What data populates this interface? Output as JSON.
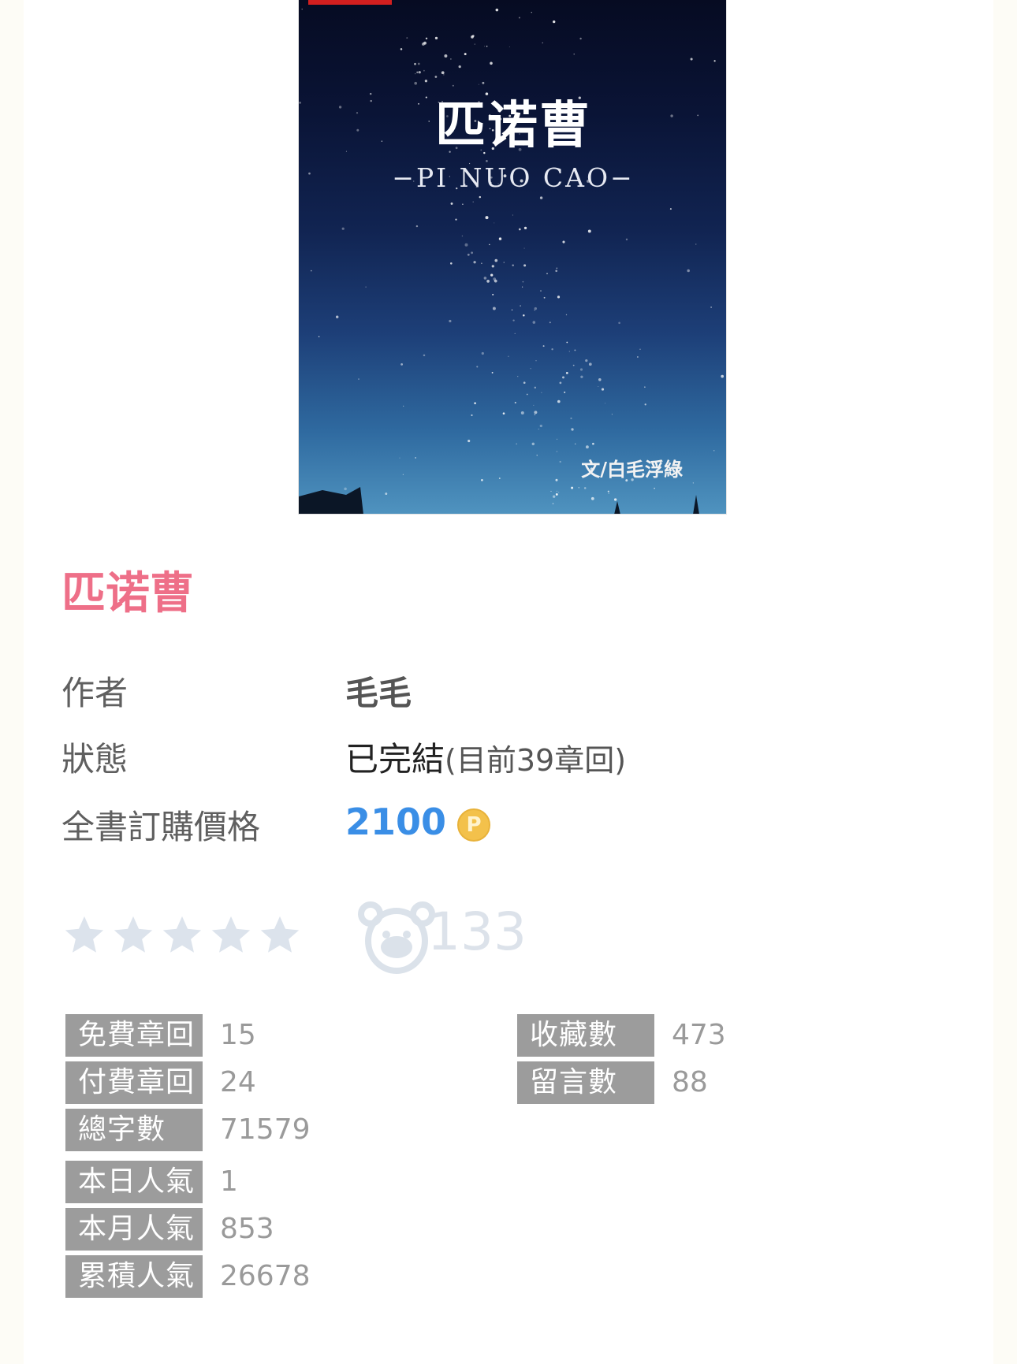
{
  "cover": {
    "title": "匹诺曹",
    "subtitle": "−PI NUO CAO−",
    "author_line": "文/白毛浮綠"
  },
  "book": {
    "title": "匹诺曹"
  },
  "info": {
    "author_label": "作者",
    "author_value": "毛毛",
    "status_label": "狀態",
    "status_value": "已完結",
    "status_detail": "(目前39章回)",
    "price_label": "全書訂購價格",
    "price_value": "2100",
    "coin_symbol": "P"
  },
  "rating": {
    "stars_filled": 0,
    "stars_total": 5,
    "star_color": "#dce3ec",
    "fans_icon": "bear-fan-icon",
    "fans_count": "133"
  },
  "stats": {
    "free_chapters_label": "免費章回",
    "free_chapters_value": "15",
    "paid_chapters_label": "付費章回",
    "paid_chapters_value": "24",
    "total_words_label": "總字數",
    "total_words_value": "71579",
    "collections_label": "收藏數",
    "collections_value": "473",
    "comments_label": "留言數",
    "comments_value": "88",
    "today_label": "本日人氣",
    "today_value": "1",
    "month_label": "本月人氣",
    "month_value": "853",
    "total_label": "累積人氣",
    "total_value": "26678"
  }
}
